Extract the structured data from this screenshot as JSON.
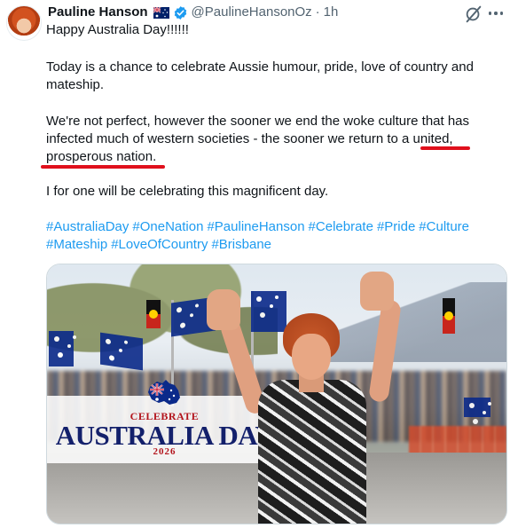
{
  "tweet": {
    "display_name": "Pauline Hanson",
    "handle": "@PaulineHansonOz",
    "separator": "·",
    "time": "1h",
    "lines": [
      "Happy Australia Day!!!!!!",
      "Today is a chance to celebrate Aussie humour, pride, love of country and",
      "mateship.",
      "We're not perfect, however the sooner we end the woke culture that has",
      "infected much of western societies - the sooner we return to a united,",
      "prosperous nation.",
      "I for one will be celebrating this magnificent day."
    ],
    "hashtags_line1": [
      "#AustraliaDay",
      "#OneNation",
      "#PaulineHanson",
      "#Celebrate",
      "#Pride",
      "#Culture"
    ],
    "hashtags_line2": [
      "#Mateship",
      "#LoveOfCountry",
      "#Brisbane"
    ]
  },
  "media": {
    "celebrate": "CELEBRATE",
    "title": "AUSTRALIA DAY",
    "year": "2026"
  },
  "icons": {
    "verified": "verified-badge-icon",
    "flag": "australian-flag-emoji",
    "grok": "grok-icon",
    "more": "more-options-icon"
  },
  "colors": {
    "link": "#1d9bf0",
    "verified": "#1d9bf0",
    "underline_annotation": "#e0101c",
    "text": "#0f1419",
    "secondary_text": "#536471"
  }
}
